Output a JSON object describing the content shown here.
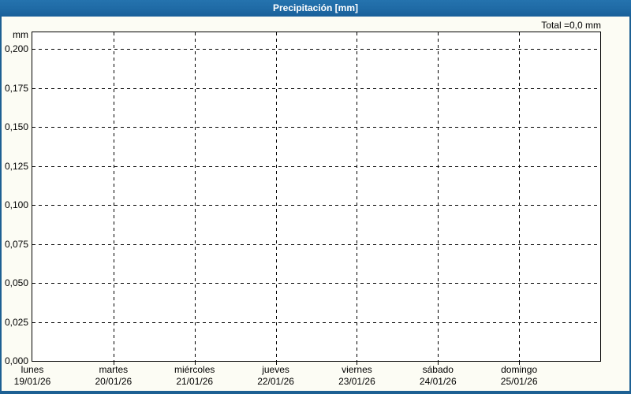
{
  "window": {
    "title": "Precipitación [mm]"
  },
  "colors": {
    "titlebar": "#1F6AA5",
    "window_border": "#1D6093",
    "content_bg": "#FCFCF4",
    "plot_bg": "#FFFFFF",
    "grid": "#000000",
    "text": "#000000",
    "title_text": "#FFFFFF"
  },
  "chart_data": {
    "type": "bar",
    "title": "Precipitación [mm]",
    "unit": "mm",
    "ylabel": "mm",
    "total_annotation": "Total =0,0 mm",
    "categories": [
      {
        "day": "lunes",
        "date": "19/01/26"
      },
      {
        "day": "martes",
        "date": "20/01/26"
      },
      {
        "day": "miércoles",
        "date": "21/01/26"
      },
      {
        "day": "jueves",
        "date": "22/01/26"
      },
      {
        "day": "viernes",
        "date": "23/01/26"
      },
      {
        "day": "sábado",
        "date": "24/01/26"
      },
      {
        "day": "domingo",
        "date": "25/01/26"
      }
    ],
    "values": [
      0,
      0,
      0,
      0,
      0,
      0,
      0
    ],
    "total": 0.0,
    "ylim": [
      0,
      0.21
    ],
    "ytick_step": 0.025,
    "ytick_labels": [
      "0,000",
      "0,025",
      "0,050",
      "0,075",
      "0,100",
      "0,125",
      "0,150",
      "0,175",
      "0,200"
    ],
    "grid": "dashed",
    "legend": "none"
  }
}
